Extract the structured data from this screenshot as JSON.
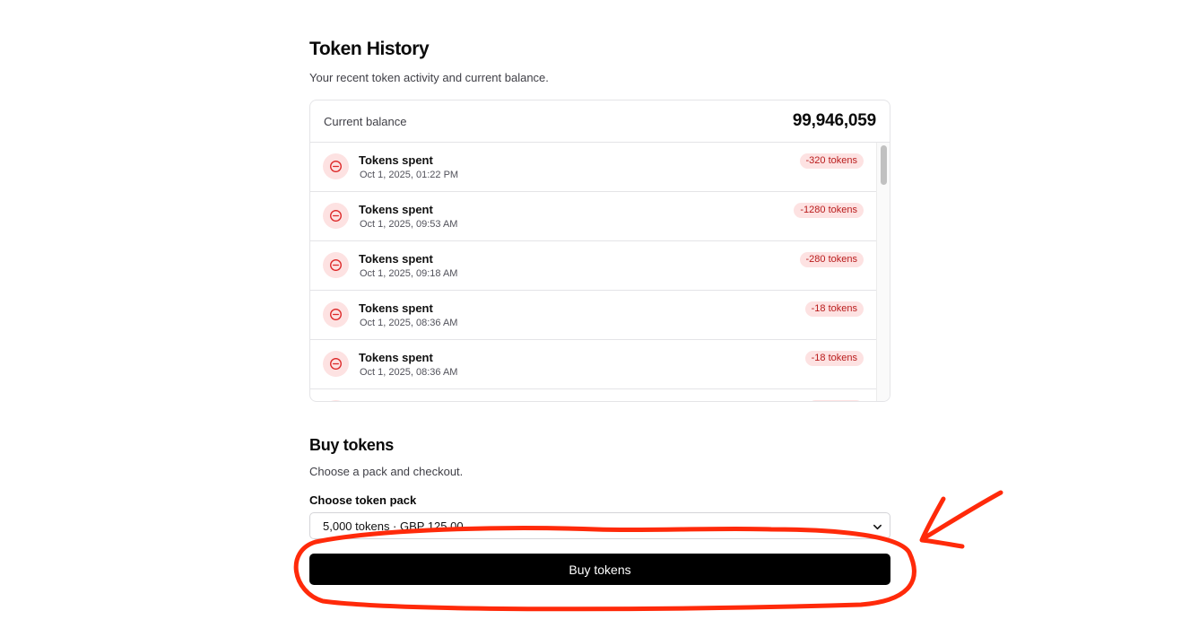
{
  "history": {
    "title": "Token History",
    "subtitle": "Your recent token activity and current balance.",
    "balance_label": "Current balance",
    "balance_value": "99,946,059",
    "entries": [
      {
        "title": "Tokens spent",
        "date": "Oct 1, 2025, 01:22 PM",
        "amount": "-320 tokens",
        "icon": "minus-circle-icon"
      },
      {
        "title": "Tokens spent",
        "date": "Oct 1, 2025, 09:53 AM",
        "amount": "-1280 tokens",
        "icon": "minus-circle-icon"
      },
      {
        "title": "Tokens spent",
        "date": "Oct 1, 2025, 09:18 AM",
        "amount": "-280 tokens",
        "icon": "minus-circle-icon"
      },
      {
        "title": "Tokens spent",
        "date": "Oct 1, 2025, 08:36 AM",
        "amount": "-18 tokens",
        "icon": "minus-circle-icon"
      },
      {
        "title": "Tokens spent",
        "date": "Oct 1, 2025, 08:36 AM",
        "amount": "-18 tokens",
        "icon": "minus-circle-icon"
      }
    ]
  },
  "buy": {
    "title": "Buy tokens",
    "subtitle": "Choose a pack and checkout.",
    "pack_label": "Choose token pack",
    "pack_selected": "5,000 tokens · GBP 125.00",
    "button_label": "Buy tokens"
  },
  "colors": {
    "danger_text": "#b91c1c",
    "danger_bg": "#fde2e2",
    "button_bg": "#000000",
    "annotation": "#ff2a0a"
  }
}
